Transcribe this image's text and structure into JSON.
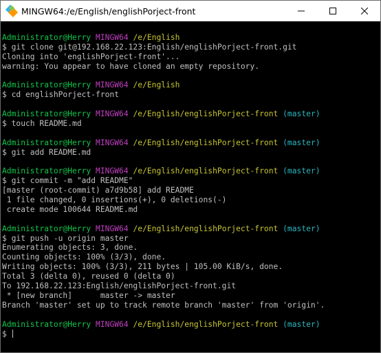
{
  "window": {
    "title": "MINGW64:/e/English/englishPorject-front",
    "icon": "git-bash-icon",
    "controls": [
      "minimize-icon",
      "maximize-icon",
      "close-icon"
    ]
  },
  "colors": {
    "background": "#000000",
    "text": "#c0c0c0",
    "user": "#13c74c",
    "env": "#bf3fbf",
    "path": "#c9c634",
    "branch": "#2ab7c0"
  },
  "terminal": {
    "prompt_user": "Administrator@Herry",
    "prompt_env": "MINGW64",
    "blocks": [
      {
        "path": "/e/English",
        "branch": "",
        "command": "$ git clone git@192.168.22.123:English/englishPorject-front.git",
        "output": [
          "Cloning into 'englishPorject-front'...",
          "warning: You appear to have cloned an empty repository."
        ]
      },
      {
        "path": "/e/English",
        "branch": "",
        "command": "$ cd englishPorject-front",
        "output": []
      },
      {
        "path": "/e/English/englishPorject-front",
        "branch": "(master)",
        "command": "$ touch README.md",
        "output": []
      },
      {
        "path": "/e/English/englishPorject-front",
        "branch": "(master)",
        "command": "$ git add README.md",
        "output": []
      },
      {
        "path": "/e/English/englishPorject-front",
        "branch": "(master)",
        "command": "$ git commit -m \"add README\"",
        "output": [
          "[master (root-commit) a7d9b58] add README",
          " 1 file changed, 0 insertions(+), 0 deletions(-)",
          " create mode 100644 README.md"
        ]
      },
      {
        "path": "/e/English/englishPorject-front",
        "branch": "(master)",
        "command": "$ git push -u origin master",
        "output": [
          "Enumerating objects: 3, done.",
          "Counting objects: 100% (3/3), done.",
          "Writing objects: 100% (3/3), 211 bytes | 105.00 KiB/s, done.",
          "Total 3 (delta 0), reused 0 (delta 0)",
          "To 192.168.22.123:English/englishPorject-front.git",
          " * [new branch]      master -> master",
          "Branch 'master' set up to track remote branch 'master' from 'origin'."
        ]
      },
      {
        "path": "/e/English/englishPorject-front",
        "branch": "(master)",
        "command": "$ ",
        "output": []
      }
    ]
  }
}
